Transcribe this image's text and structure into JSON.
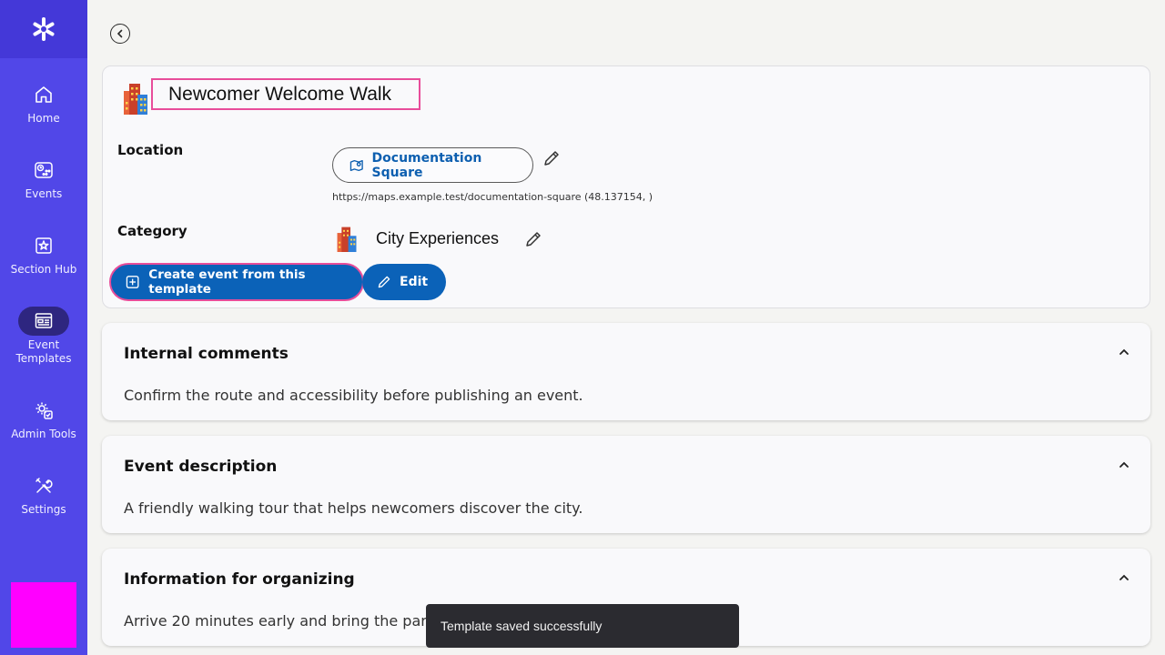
{
  "sidebar": {
    "items": [
      {
        "label": "Home",
        "icon": "home-icon"
      },
      {
        "label": "Events",
        "icon": "events-icon"
      },
      {
        "label": "Section Hub",
        "icon": "section-hub-icon"
      },
      {
        "label": "Event Templates",
        "icon": "templates-icon",
        "active": true
      },
      {
        "label": "Admin Tools",
        "icon": "admin-tools-icon"
      },
      {
        "label": "Settings",
        "icon": "settings-icon"
      }
    ],
    "colors": {
      "background": "#5147e8",
      "logo_bg": "#4438d8",
      "active_pill": "#2e2680",
      "block": "#ff00ff"
    }
  },
  "template": {
    "title": "Newcomer Welcome Walk",
    "location_label": "Location",
    "location_name": "Documentation Square",
    "location_url": "https://maps.example.test/documentation-square (48.137154, )",
    "category_label": "Category",
    "category_name": "City Experiences",
    "create_button": "Create event from this template",
    "edit_button": "Edit"
  },
  "sections": [
    {
      "title": "Internal comments",
      "body": "Confirm the route and accessibility before publishing an event."
    },
    {
      "title": "Event description",
      "body": "A friendly walking tour that helps newcomers discover the city."
    },
    {
      "title": "Information for organizing",
      "body": "Arrive 20 minutes early and bring the partici"
    }
  ],
  "toast": {
    "message": "Template saved successfully"
  },
  "colors": {
    "primary": "#0b62b8",
    "highlight": "#e84d9a",
    "link": "#0d5fb0"
  }
}
